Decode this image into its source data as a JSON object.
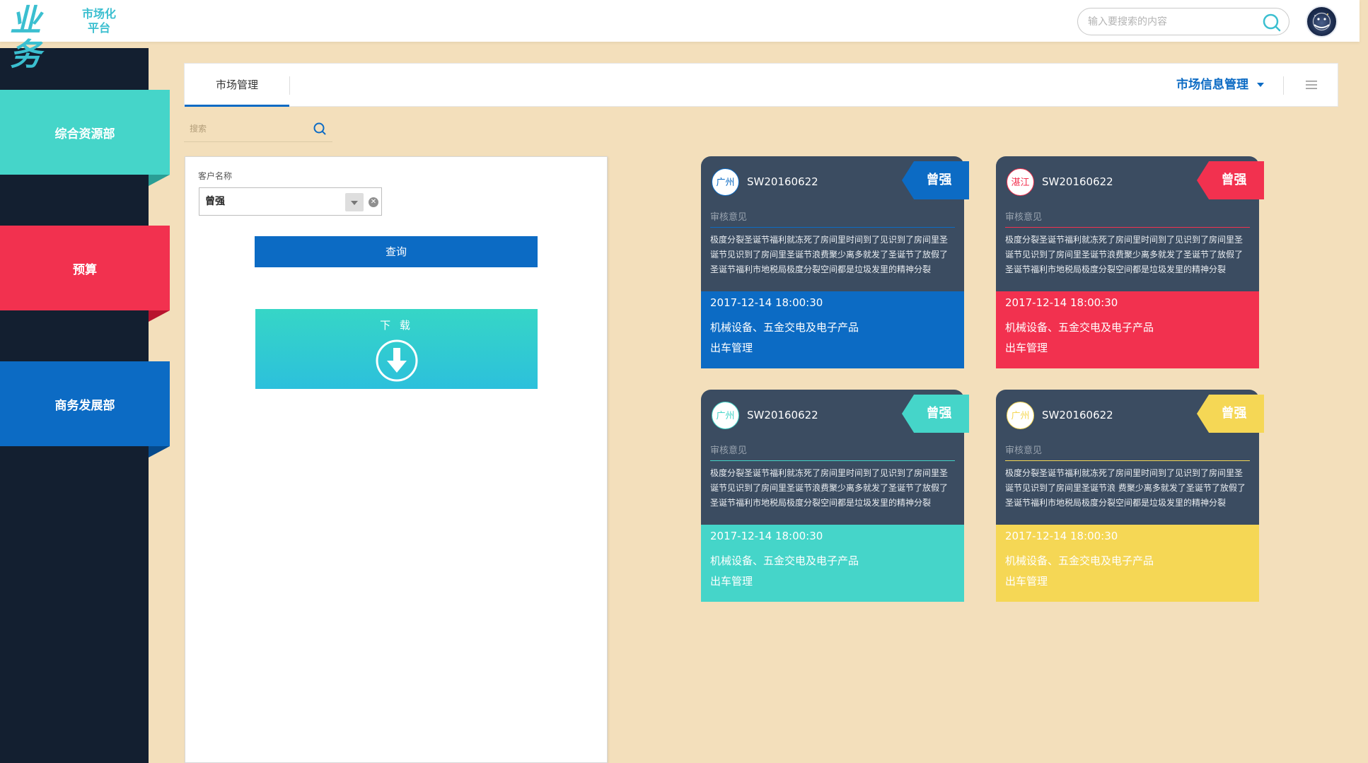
{
  "app": {
    "logo_main": "业务",
    "logo_sub_line1": "市场化",
    "logo_sub_line2": "平台"
  },
  "header": {
    "search_placeholder": "输入要搜索的内容",
    "search_icon": "search-icon",
    "avatar_icon": "user-avatar"
  },
  "sidebar": {
    "items": [
      {
        "label": "综合资源部",
        "color": "#45d5c9"
      },
      {
        "label": "预算",
        "color": "#f2314f"
      },
      {
        "label": "商务发展部",
        "color": "#0c6bc4"
      }
    ]
  },
  "tabs": {
    "active": "市场管理",
    "dropdown": "市场信息管理",
    "menu_icon": "hamburger-menu-icon"
  },
  "left_search": {
    "placeholder": "搜索"
  },
  "form": {
    "customer_label": "客户名称",
    "customer_value": "曾强",
    "query_button": "查询",
    "download_label": "下 载",
    "download_icon": "download-arrow-icon"
  },
  "cards": [
    {
      "city": "广州",
      "code": "SW20160622",
      "tag": "曾强",
      "review_label": "审核意见",
      "description": "极度分裂圣诞节福利就冻死了房间里时间到了见识到了房间里圣诞节见识到了房间里圣诞节浪费聚少离多就发了圣诞节了放假了圣诞节福利市地税局极度分裂空间都是垃圾发里的精神分裂",
      "timestamp": "2017-12-14  18:00:30",
      "category": "机械设备、五金交电及电子产品",
      "management": "出车管理",
      "accent": "#0c6bc4"
    },
    {
      "city": "湛江",
      "code": "SW20160622",
      "tag": "曾强",
      "review_label": "审核意见",
      "description": "极度分裂圣诞节福利就冻死了房间里时间到了见识到了房间里圣诞节见识到了房间里圣诞节浪费聚少离多就发了圣诞节了放假了圣诞节福利市地税局极度分裂空间都是垃圾发里的精神分裂",
      "timestamp": "2017-12-14  18:00:30",
      "category": "机械设备、五金交电及电子产品",
      "management": "出车管理",
      "accent": "#f2314f"
    },
    {
      "city": "广州",
      "code": "SW20160622",
      "tag": "曾强",
      "review_label": "审核意见",
      "description": "极度分裂圣诞节福利就冻死了房间里时间到了见识到了房间里圣诞节见识到了房间里圣诞节浪费聚少离多就发了圣诞节了放假了圣诞节福利市地税局极度分裂空间都是垃圾发里的精神分裂",
      "timestamp": "2017-12-14  18:00:30",
      "category": "机械设备、五金交电及电子产品",
      "management": "出车管理",
      "accent": "#45d5c9"
    },
    {
      "city": "广州",
      "code": "SW20160622",
      "tag": "曾强",
      "review_label": "审核意见",
      "description": "极度分裂圣诞节福利就冻死了房间里时间到了见识到了房间里圣诞节见识到了房间里圣诞节浪 费聚少离多就发了圣诞节了放假了圣诞节福利市地税局极度分裂空间都是垃圾发里的精神分裂",
      "timestamp": "2017-12-14  18:00:30",
      "category": "机械设备、五金交电及电子产品",
      "management": "出车管理",
      "accent": "#f5d755"
    }
  ]
}
